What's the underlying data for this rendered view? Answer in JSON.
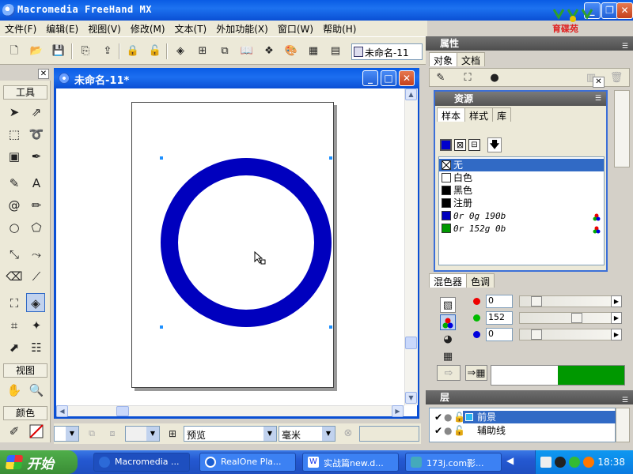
{
  "app": {
    "title": "Macromedia FreeHand MX",
    "logo_text": "育碟苑"
  },
  "menu": [
    "文件(F)",
    "编辑(E)",
    "视图(V)",
    "修改(M)",
    "文本(T)",
    "外加功能(X)",
    "窗口(W)",
    "帮助(H)"
  ],
  "toolbar": {
    "document_selector": "未命名-11"
  },
  "tools_panel": {
    "title": "工具",
    "view_label": "视图",
    "colors_label": "颜色"
  },
  "document": {
    "title": "未命名-11*",
    "ring_color": "#0000be"
  },
  "statusbar": {
    "page_value": "",
    "view_mode": "预览",
    "units": "毫米"
  },
  "properties": {
    "title": "属性",
    "tabs": [
      "对象",
      "文档"
    ]
  },
  "assets": {
    "title": "资源",
    "tabs": [
      "样本",
      "样式",
      "库"
    ],
    "colors": [
      {
        "name": "无",
        "swatch": "none",
        "selected": true
      },
      {
        "name": "白色",
        "swatch": "#ffffff"
      },
      {
        "name": "黑色",
        "swatch": "#000000"
      },
      {
        "name": "注册",
        "swatch": "#000000"
      },
      {
        "name": "0r 0g 190b",
        "swatch": "#0000be",
        "italic": true
      },
      {
        "name": "0r 152g 0b",
        "swatch": "#009800",
        "italic": true
      }
    ]
  },
  "mixer": {
    "tabs": [
      "混色器",
      "色调"
    ],
    "r": "0",
    "g": "152",
    "b": "0",
    "r_level": 0,
    "g_level": 0.596,
    "b_level": 0,
    "color": "#009800"
  },
  "layers": {
    "title": "层",
    "items": [
      "前景",
      "辅助线"
    ]
  },
  "taskbar": {
    "start": "开始",
    "tasks": [
      "Macromedia ...",
      "RealOne Pla...",
      "实战篇new.d...",
      "173j.com影..."
    ],
    "clock": "18:38"
  }
}
